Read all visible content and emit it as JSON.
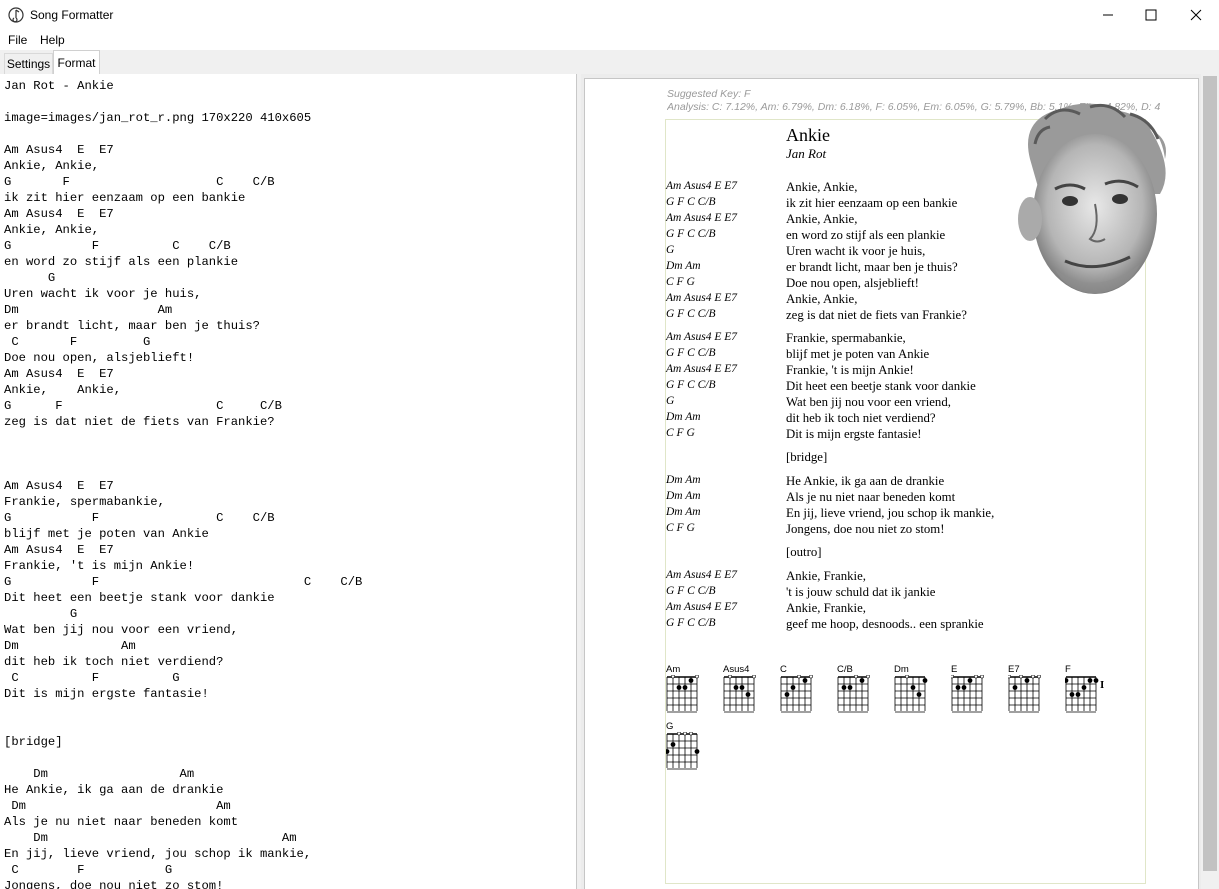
{
  "window": {
    "title": "Song Formatter",
    "controls": {
      "minimize": "minimize-icon",
      "maximize": "maximize-icon",
      "close": "close-icon"
    }
  },
  "menu": {
    "items": [
      "File",
      "Help"
    ]
  },
  "tabs": [
    {
      "label": "Settings",
      "active": false
    },
    {
      "label": "Format",
      "active": true
    }
  ],
  "editor": {
    "lines": [
      "Jan Rot - Ankie",
      "",
      "image=images/jan_rot_r.png 170x220 410x605",
      "",
      "Am Asus4  E  E7",
      "Ankie, Ankie,",
      "G       F                    C    C/B",
      "ik zit hier eenzaam op een bankie",
      "Am Asus4  E  E7",
      "Ankie, Ankie,",
      "G           F          C    C/B",
      "en word zo stijf als een plankie",
      "      G",
      "Uren wacht ik voor je huis,",
      "Dm                   Am",
      "er brandt licht, maar ben je thuis?",
      " C       F         G",
      "Doe nou open, alsjeblieft!",
      "Am Asus4  E  E7",
      "Ankie,    Ankie,",
      "G      F                     C     C/B",
      "zeg is dat niet de fiets van Frankie?",
      "",
      "",
      "",
      "Am Asus4  E  E7",
      "Frankie, spermabankie,",
      "G           F                C    C/B",
      "blijf met je poten van Ankie",
      "Am Asus4  E  E7",
      "Frankie, 't is mijn Ankie!",
      "G           F                            C    C/B",
      "Dit heet een beetje stank voor dankie",
      "         G",
      "Wat ben jij nou voor een vriend,",
      "Dm              Am",
      "dit heb ik toch niet verdiend?",
      " C          F          G",
      "Dit is mijn ergste fantasie!",
      "",
      "",
      "[bridge]",
      "",
      "    Dm                  Am",
      "He Ankie, ik ga aan de drankie",
      " Dm                          Am",
      "Als je nu niet naar beneden komt",
      "    Dm                                Am",
      "En jij, lieve vriend, jou schop ik mankie,",
      " C        F           G",
      "Jongens, doe nou niet zo stom!"
    ]
  },
  "preview": {
    "suggested_key": "Suggested Key: F",
    "analysis": "Analysis: C: 7.12%, Am: 6.79%, Dm: 6.18%, F: 6.05%, Em: 6.05%, G: 5.79%, Bb: 5.1%, F#m: 4.82%, D: 4",
    "song_title": "Ankie",
    "song_artist": "Jan Rot",
    "portrait_icon": "portrait-photo",
    "verses": [
      {
        "lines": [
          {
            "chords": "Am Asus4 E E7",
            "lyric": "Ankie, Ankie,"
          },
          {
            "chords": "G F C C/B",
            "lyric": "ik zit hier eenzaam op een bankie"
          },
          {
            "chords": "Am Asus4 E E7",
            "lyric": "Ankie, Ankie,"
          },
          {
            "chords": "G F C C/B",
            "lyric": "en word zo stijf als een plankie"
          },
          {
            "chords": "G",
            "lyric": "Uren wacht ik voor je huis,"
          },
          {
            "chords": "Dm Am",
            "lyric": "er brandt licht, maar ben je thuis?"
          },
          {
            "chords": "C F G",
            "lyric": "Doe nou open, alsjeblieft!"
          },
          {
            "chords": "Am Asus4 E E7",
            "lyric": "Ankie,    Ankie,"
          },
          {
            "chords": "G F C C/B",
            "lyric": "zeg is dat niet de fiets van Frankie?"
          }
        ]
      },
      {
        "lines": [
          {
            "chords": "Am Asus4 E E7",
            "lyric": "Frankie, spermabankie,"
          },
          {
            "chords": "G F C C/B",
            "lyric": "blijf met je poten van Ankie"
          },
          {
            "chords": "Am Asus4 E E7",
            "lyric": "Frankie, 't is mijn Ankie!"
          },
          {
            "chords": "G F C C/B",
            "lyric": "Dit heet een beetje stank voor dankie"
          },
          {
            "chords": "G",
            "lyric": "Wat ben jij nou voor een vriend,"
          },
          {
            "chords": "Dm Am",
            "lyric": "dit heb ik toch niet verdiend?"
          },
          {
            "chords": "C F G",
            "lyric": "Dit is mijn ergste fantasie!"
          }
        ]
      },
      {
        "section": "[bridge]",
        "lines": [
          {
            "chords": "Dm Am",
            "lyric": "He Ankie, ik ga aan de drankie"
          },
          {
            "chords": "Dm Am",
            "lyric": "Als je nu niet naar beneden komt"
          },
          {
            "chords": "Dm Am",
            "lyric": "En jij, lieve vriend, jou schop ik mankie,"
          },
          {
            "chords": "C F G",
            "lyric": "Jongens, doe nou niet zo stom!"
          }
        ]
      },
      {
        "section": "[outro]",
        "lines": [
          {
            "chords": "Am Asus4 E E7",
            "lyric": "Ankie, Frankie,"
          },
          {
            "chords": "G F C C/B",
            "lyric": "'t is jouw schuld dat ik jankie"
          },
          {
            "chords": "Am Asus4 E E7",
            "lyric": "Ankie, Frankie,"
          },
          {
            "chords": "G F C C/B",
            "lyric": "geef me hoop, desnoods.. een sprankie"
          }
        ]
      }
    ],
    "chord_diagrams": [
      {
        "name": "Am",
        "frets": [
          -1,
          0,
          2,
          2,
          1,
          0
        ]
      },
      {
        "name": "Asus4",
        "frets": [
          -1,
          0,
          2,
          2,
          3,
          0
        ]
      },
      {
        "name": "C",
        "frets": [
          -1,
          3,
          2,
          0,
          1,
          0
        ]
      },
      {
        "name": "C/B",
        "frets": [
          -1,
          2,
          2,
          0,
          1,
          0
        ]
      },
      {
        "name": "Dm",
        "frets": [
          -1,
          -1,
          0,
          2,
          3,
          1
        ]
      },
      {
        "name": "E",
        "frets": [
          0,
          2,
          2,
          1,
          0,
          0
        ]
      },
      {
        "name": "E7",
        "frets": [
          0,
          2,
          0,
          1,
          0,
          0
        ]
      },
      {
        "name": "F",
        "frets": [
          1,
          3,
          3,
          2,
          1,
          1
        ],
        "barre": "I"
      },
      {
        "name": "G",
        "frets": [
          3,
          2,
          0,
          0,
          0,
          3
        ]
      }
    ]
  }
}
